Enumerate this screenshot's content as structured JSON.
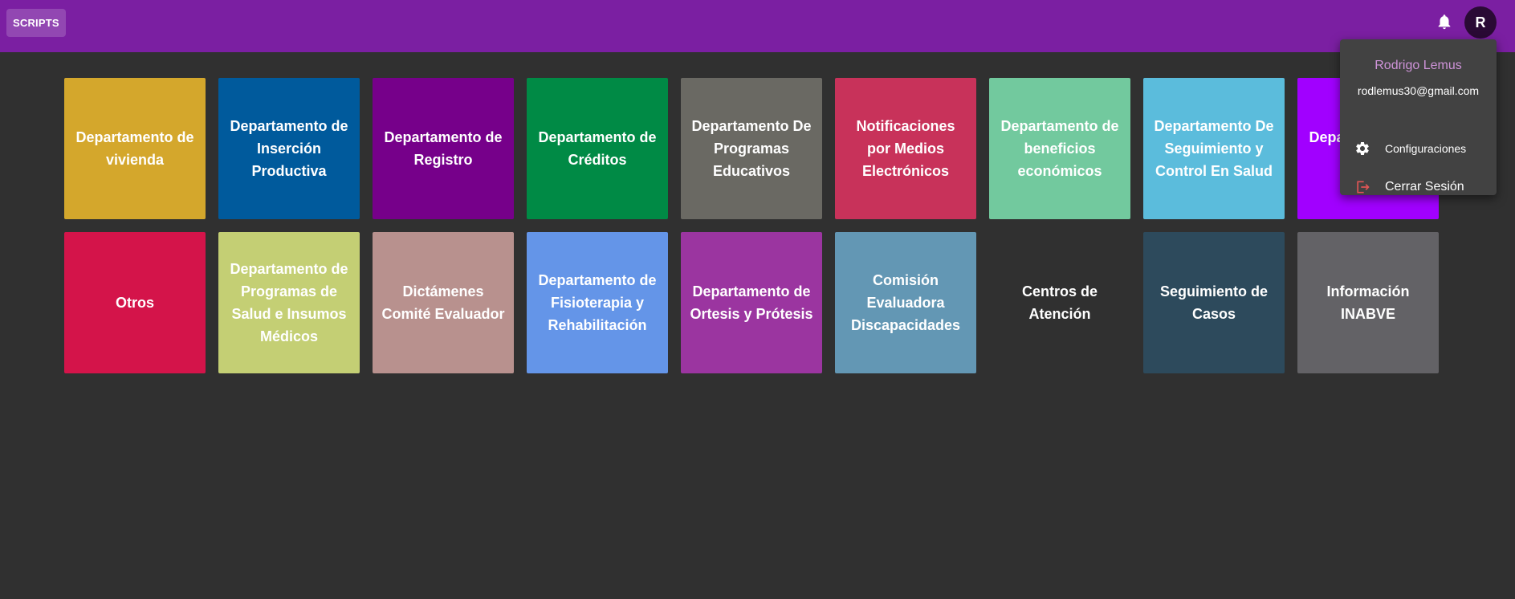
{
  "header": {
    "scripts_label": "SCRIPTS",
    "notification_icon": "bell-icon",
    "avatar_initial": "R"
  },
  "tiles": [
    {
      "label": "Departamento de vivienda",
      "color": "#d4a72c"
    },
    {
      "label": "Departamento de Inserción Productiva",
      "color": "#005a9c"
    },
    {
      "label": "Departamento de Registro",
      "color": "#76008a"
    },
    {
      "label": "Departamento de Créditos",
      "color": "#008a45"
    },
    {
      "label": "Departamento De Programas Educativos",
      "color": "#6a6963"
    },
    {
      "label": "Notificaciones por Medios Electrónicos",
      "color": "#c8325a"
    },
    {
      "label": "Departamento de beneficios económicos",
      "color": "#72c99e"
    },
    {
      "label": "Departamento De Seguimiento y Control En Salud",
      "color": "#5bbcdc"
    },
    {
      "label": "Departamento de Salud",
      "color": "#a100ff"
    },
    {
      "label": "Otros",
      "color": "#d4144a"
    },
    {
      "label": "Departamento de Programas de Salud e Insumos Médicos",
      "color": "#c4cf74"
    },
    {
      "label": "Dictámenes Comité Evaluador",
      "color": "#b8918e"
    },
    {
      "label": "Departamento de Fisioterapia y Rehabilitación",
      "color": "#6495e8"
    },
    {
      "label": "Departamento de Ortesis y Prótesis",
      "color": "#9b35a0"
    },
    {
      "label": "Comisión Evaluadora Discapacidades",
      "color": "#6397b4"
    },
    {
      "label": "Centros de Atención",
      "color": "#303030"
    },
    {
      "label": "Seguimiento de Casos",
      "color": "#2d4a5c"
    },
    {
      "label": "Información INABVE",
      "color": "#636266"
    }
  ],
  "user_menu": {
    "name": "Rodrigo Lemus",
    "email": "rodlemus30@gmail.com",
    "items": [
      {
        "label": "Configuraciones",
        "icon": "gear-icon"
      },
      {
        "label": "Cerrar Sesión",
        "icon": "logout-icon"
      }
    ]
  },
  "colors": {
    "topbar": "#7b1fa2",
    "background": "#303030",
    "menu_background": "#424242",
    "menu_name": "#ce93d8",
    "logout_icon": "#e05555"
  }
}
